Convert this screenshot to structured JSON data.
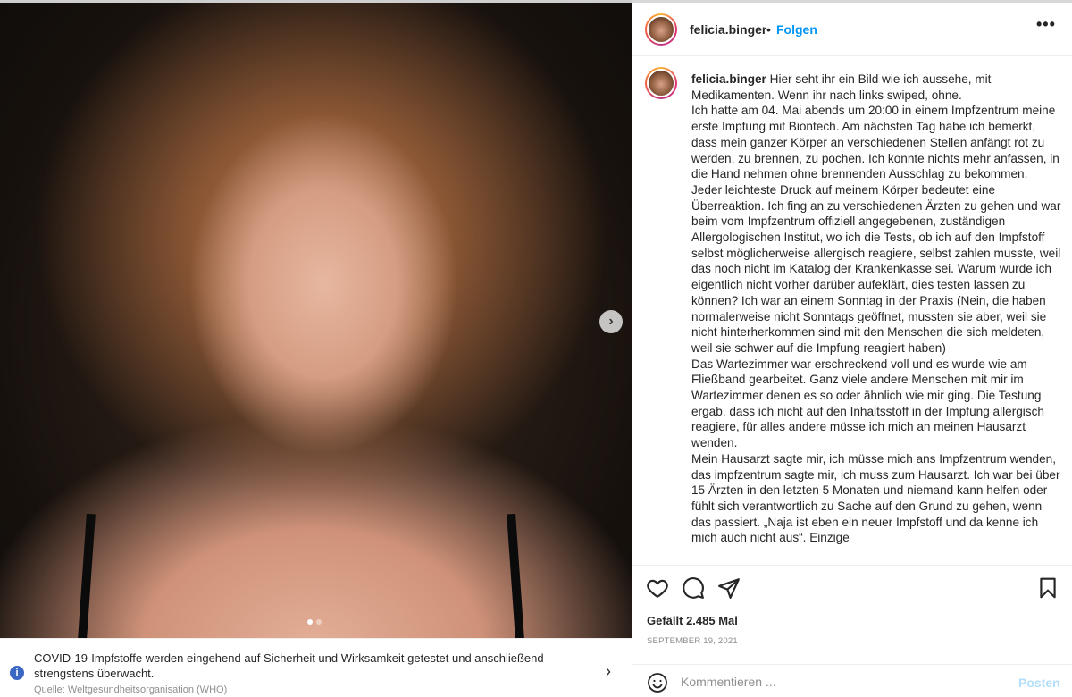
{
  "post": {
    "username": "felicia.binger",
    "follow_label": "Folgen",
    "separator": "•",
    "more_label": "•••",
    "carousel": {
      "slide_count": 2,
      "current_slide": 1
    },
    "caption_paragraphs": [
      "Hier seht ihr ein Bild wie ich aussehe, mit Medikamenten. Wenn ihr nach links swiped, ohne.",
      "Ich hatte am 04. Mai abends um 20:00 in einem Impfzentrum meine erste Impfung mit Biontech. Am nächsten Tag habe ich bemerkt, dass mein ganzer Körper an verschiedenen Stellen anfängt rot zu werden, zu brennen, zu pochen. Ich konnte nichts mehr anfassen, in die Hand nehmen ohne brennenden Ausschlag zu bekommen. Jeder leichteste Druck auf meinem Körper bedeutet eine Überreaktion. Ich fing an zu verschiedenen Ärzten zu gehen und war beim vom Impfzentrum offiziell angegebenen, zuständigen Allergologischen Institut, wo ich die Tests, ob ich auf den Impfstoff selbst möglicherweise allergisch reagiere, selbst zahlen musste, weil das noch nicht im Katalog der Krankenkasse sei. Warum wurde ich eigentlich nicht vorher darüber aufeklärt, dies testen lassen zu können? Ich war an einem Sonntag in der Praxis (Nein, die haben normalerweise nicht Sonntags geöffnet, mussten sie aber, weil sie nicht hinterherkommen sind mit den Menschen die sich meldeten, weil sie schwer auf die Impfung reagiert haben)",
      "Das Wartezimmer war erschreckend voll und es wurde wie am Fließband gearbeitet. Ganz viele andere Menschen mit mir im Wartezimmer denen es so oder ähnlich wie mir ging. Die Testung ergab, dass ich nicht auf den Inhaltsstoff in der Impfung allergisch reagiere, für alles andere müsse ich mich an meinen Hausarzt wenden.",
      "Mein Hausarzt sagte mir, ich müsse mich ans Impfzentrum wenden, das impfzentrum sagte mir, ich muss zum Hausarzt. Ich war bei über 15 Ärzten in den letzten 5 Monaten und niemand kann helfen oder fühlt sich verantwortlich zu Sache auf den Grund zu gehen, wenn das passiert. „Naja ist eben ein neuer Impfstoff und da kenne ich mich auch nicht aus“. Einzige"
    ],
    "likes_text": "Gefällt 2.485 Mal",
    "date_text": "SEPTEMBER 19, 2021",
    "comment_placeholder": "Kommentieren ...",
    "post_label": "Posten",
    "colors": {
      "link": "#0095f6",
      "post_disabled": "#b2dffc",
      "muted": "#8e8e8e"
    }
  },
  "covid_banner": {
    "message": "COVID-19-Impfstoffe werden eingehend auf Sicherheit und Wirksamkeit getestet und anschließend strengstens überwacht.",
    "source": "Quelle: Weltgesundheitsorganisation (WHO)",
    "info_icon_glyph": "i",
    "chevron_glyph": "›"
  },
  "icons": [
    "heart-icon",
    "comment-icon",
    "share-icon",
    "bookmark-icon",
    "emoji-icon",
    "info-icon",
    "chevron-right-icon"
  ]
}
